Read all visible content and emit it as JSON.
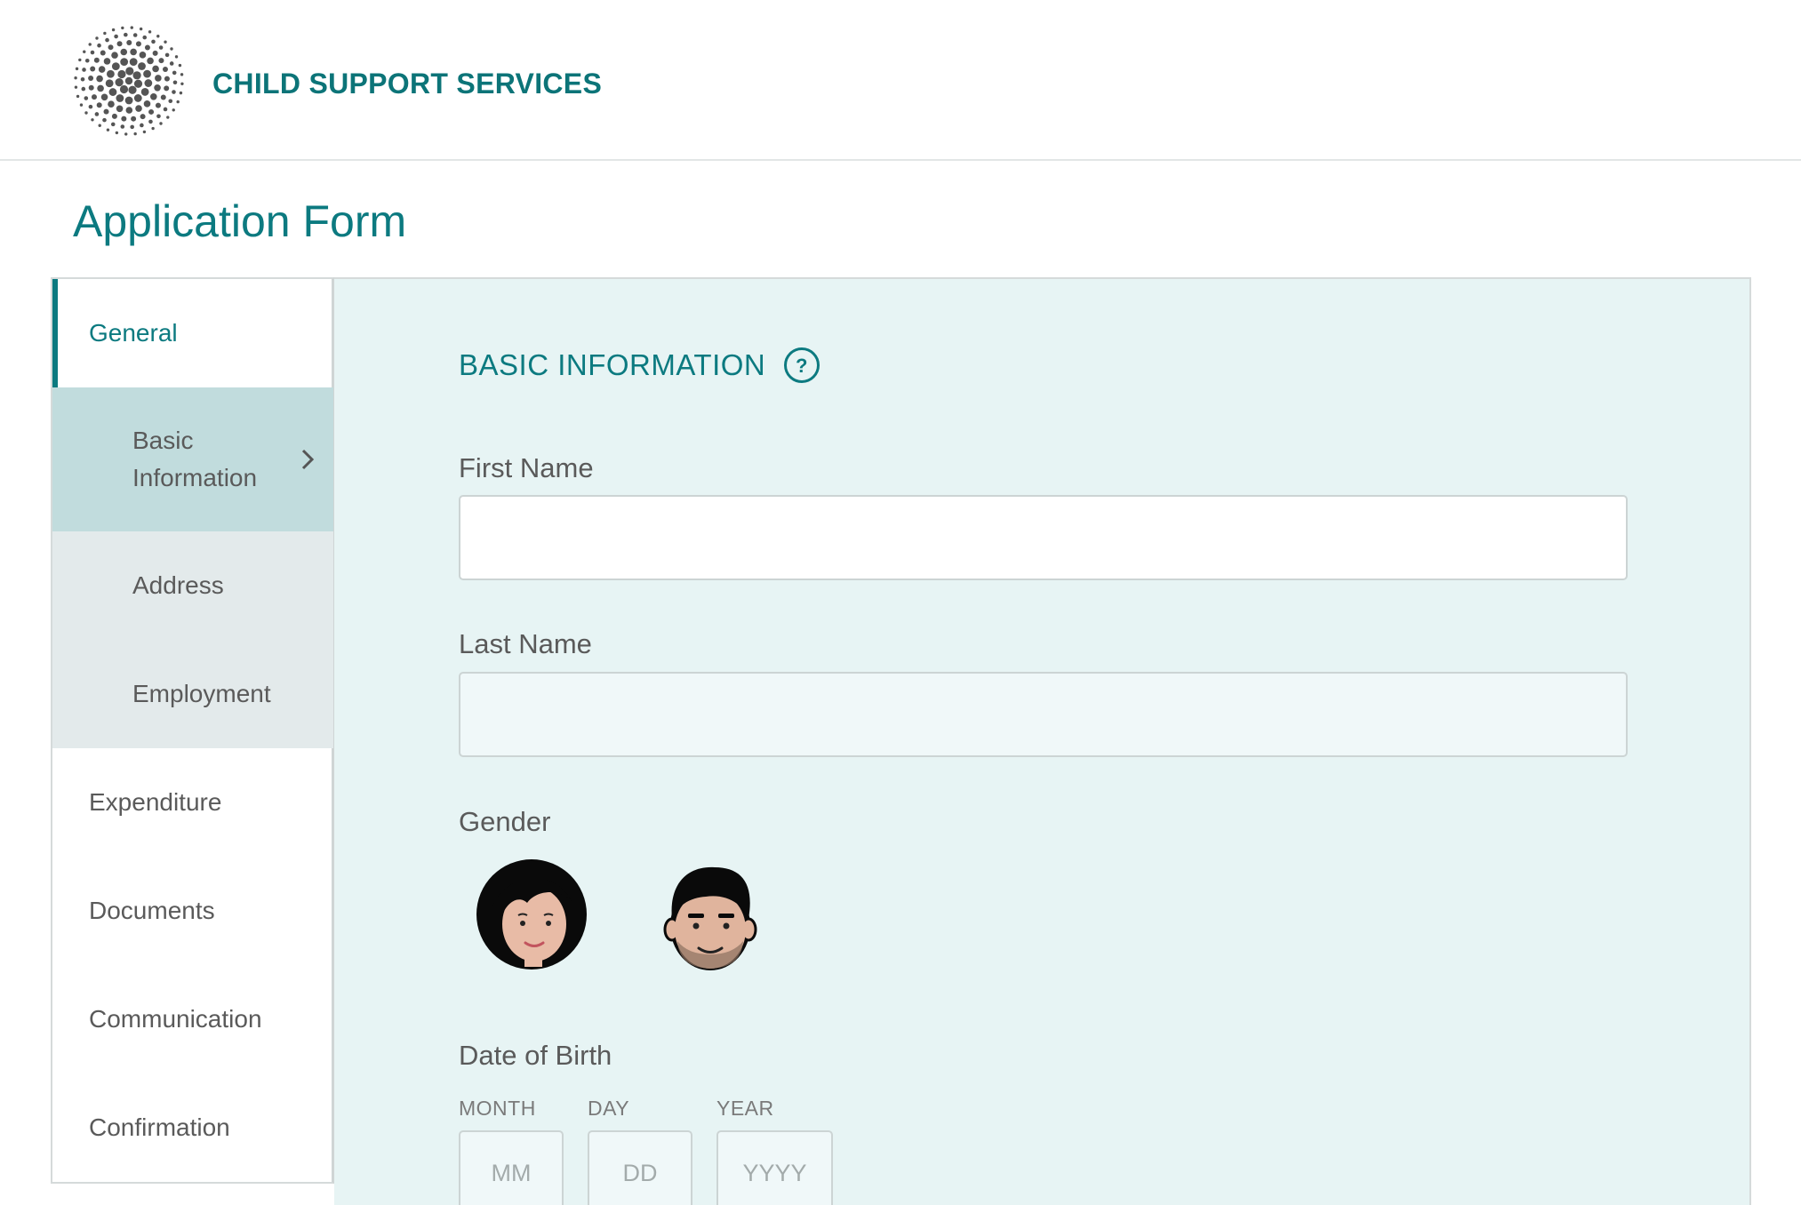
{
  "header": {
    "brand": "CHILD SUPPORT SERVICES",
    "logo_icon": "dotted-circle-logo-icon"
  },
  "page": {
    "title": "Application Form"
  },
  "sidebar": {
    "items": [
      {
        "label": "General",
        "state": "active-parent"
      },
      {
        "label": "Basic Information",
        "state": "active-sub"
      },
      {
        "label": "Address",
        "state": "sub"
      },
      {
        "label": "Employment",
        "state": "sub"
      },
      {
        "label": "Expenditure",
        "state": "top"
      },
      {
        "label": "Documents",
        "state": "top"
      },
      {
        "label": "Communication",
        "state": "top"
      },
      {
        "label": "Confirmation",
        "state": "top"
      }
    ],
    "chevron_icon": "chevron-right-icon"
  },
  "form": {
    "section_title": "BASIC INFORMATION",
    "help_icon": "question-circle-icon",
    "first_name": {
      "label": "First Name",
      "value": ""
    },
    "last_name": {
      "label": "Last Name",
      "value": ""
    },
    "gender": {
      "label": "Gender",
      "options": [
        {
          "icon": "female-avatar-icon"
        },
        {
          "icon": "male-avatar-icon"
        }
      ]
    },
    "dob": {
      "label": "Date of Birth",
      "month": {
        "label": "MONTH",
        "placeholder": "MM"
      },
      "day": {
        "label": "DAY",
        "placeholder": "DD"
      },
      "year": {
        "label": "YEAR",
        "placeholder": "YYYY"
      }
    }
  },
  "colors": {
    "accent": "#0c7a80",
    "panel_bg": "#e7f4f4",
    "sub_nav_bg": "#e3eaeb",
    "active_sub_bg": "#c1dcdd"
  }
}
